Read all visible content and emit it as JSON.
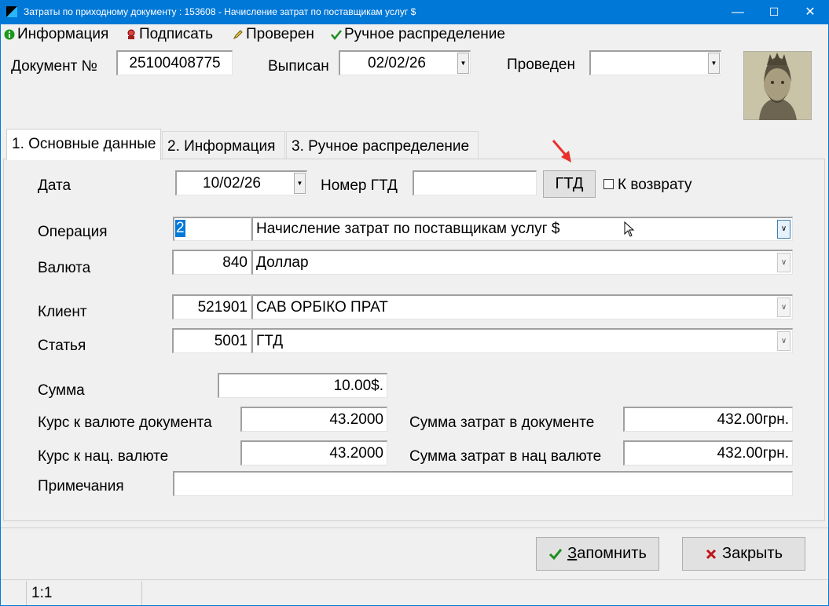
{
  "window": {
    "title": "Затраты по приходному документу : 153608 - Начисление затрат по поставщикам услуг $",
    "minimize": "—",
    "maximize": "☐",
    "close": "✕"
  },
  "menu": {
    "info": "Информация",
    "sign": "Подписать",
    "checked": "Проверен",
    "manual": "Ручное распределение"
  },
  "header": {
    "doc_label": "Документ №",
    "doc_number": "25100408775",
    "issued_label": "Выписан",
    "issued_date": "02/02/26",
    "posted_label": "Проведен",
    "posted_value": ""
  },
  "tabs": [
    {
      "label": "1. Основные данные"
    },
    {
      "label": "2. Информация"
    },
    {
      "label": "3. Ручное распределение"
    }
  ],
  "form": {
    "date_label": "Дата",
    "date_value": "10/02/26",
    "gtd_label": "Номер ГТД",
    "gtd_value": "",
    "gtd_button": "ГТД",
    "return_label": "К возврату",
    "operation_label": "Операция",
    "operation_code": "2",
    "operation_name": "Начисление затрат по поставщикам услуг $",
    "currency_label": "Валюта",
    "currency_code": "840",
    "currency_name": "Доллар",
    "client_label": "Клиент",
    "client_code": "521901",
    "client_name": "САВ ОРБІКО ПРАТ",
    "article_label": "Статья",
    "article_code": "5001",
    "article_name": "ГТД",
    "sum_label": "Сумма",
    "sum_value": "10.00$.",
    "rate_doc_label": "Курс к валюте документа",
    "rate_doc_value": "43.2000",
    "cost_doc_label": "Сумма затрат в документе",
    "cost_doc_value": "432.00грн.",
    "rate_nat_label": "Курс к нац. валюте",
    "rate_nat_value": "43.2000",
    "cost_nat_label": "Сумма затрат в нац валюте",
    "cost_nat_value": "432.00грн.",
    "notes_label": "Примечания",
    "notes_value": ""
  },
  "footer": {
    "save_hotkey": "З",
    "save_rest": "апомнить",
    "close_label": "Закрыть",
    "status": "1:1"
  },
  "colors": {
    "titlebar": "#0078d7",
    "save_check": "#1f8f1f",
    "close_x": "#c0141c",
    "annotation_arrow": "#e8312a"
  }
}
